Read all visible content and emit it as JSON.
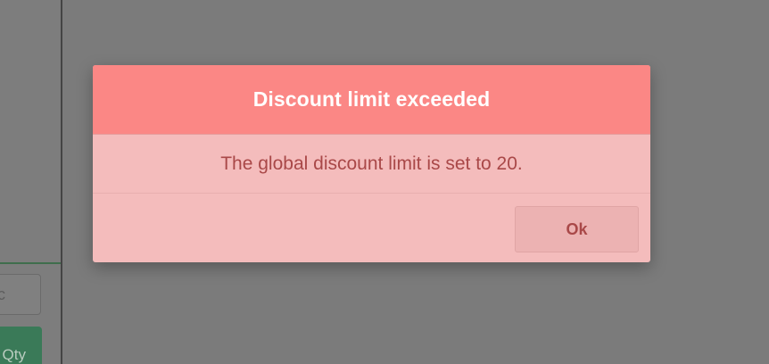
{
  "background": {
    "input_fragment": "c",
    "qty_button_label": "Qty"
  },
  "dialog": {
    "title": "Discount limit exceeded",
    "message": "The global discount limit is set to 20.",
    "ok_label": "Ok",
    "colors": {
      "header": "#fb8785",
      "body": "#f4bcbc",
      "title_text": "#ffffff",
      "message_text": "#a94848",
      "overlay": "#7b7b7b",
      "qty_button": "#3a7a58"
    }
  }
}
